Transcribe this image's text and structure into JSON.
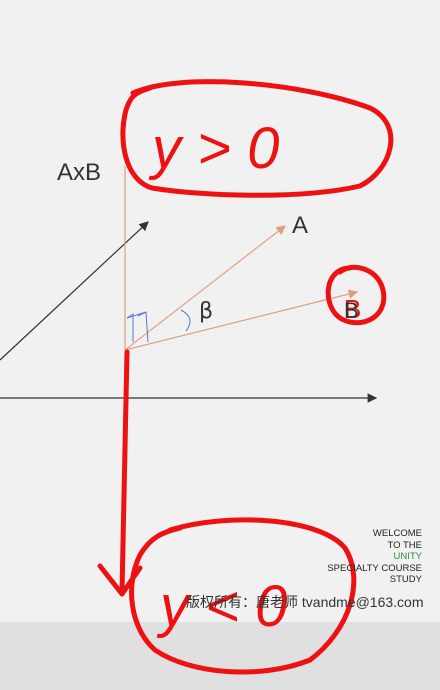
{
  "labels": {
    "cross": "AxB",
    "vecA": "A",
    "vecB": "B",
    "angle": "β"
  },
  "annotations": {
    "top": "y > 0",
    "bottom": "y < 0",
    "circledB": "B"
  },
  "watermark": {
    "line1": "WELCOME",
    "line2": "TO THE",
    "line3": "UNITY",
    "line4": "SPECIALTY COURSE",
    "line5": "STUDY"
  },
  "copyright": "版权所有：唐老师 tvandme@163.com",
  "colors": {
    "vector": "#e0a080",
    "axis": "#333333",
    "ink": "#ee1111",
    "unity": "#2e8b3a"
  }
}
